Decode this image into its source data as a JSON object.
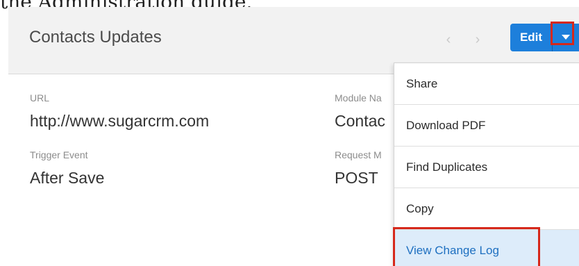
{
  "document": {
    "heading_fragment": "the Administration guide."
  },
  "record": {
    "title": "Contacts Updates",
    "prev_icon": "chevron-left-icon",
    "next_icon": "chevron-right-icon",
    "edit_label": "Edit",
    "caret_icon": "caret-down-icon",
    "accent_color": "#1d7fdb",
    "highlight_color": "#d6281b"
  },
  "fields": {
    "url": {
      "label": "URL",
      "value": "http://www.sugarcrm.com"
    },
    "trigger_event": {
      "label": "Trigger Event",
      "value": "After Save"
    },
    "module_name": {
      "label": "Module Na",
      "value": "Contac"
    },
    "request_method": {
      "label": "Request M",
      "value": "POST"
    }
  },
  "menu": {
    "items": [
      {
        "label": "Share"
      },
      {
        "label": "Download PDF"
      },
      {
        "label": "Find Duplicates"
      },
      {
        "label": "Copy"
      },
      {
        "label": "View Change Log"
      }
    ],
    "active_index": 4
  }
}
